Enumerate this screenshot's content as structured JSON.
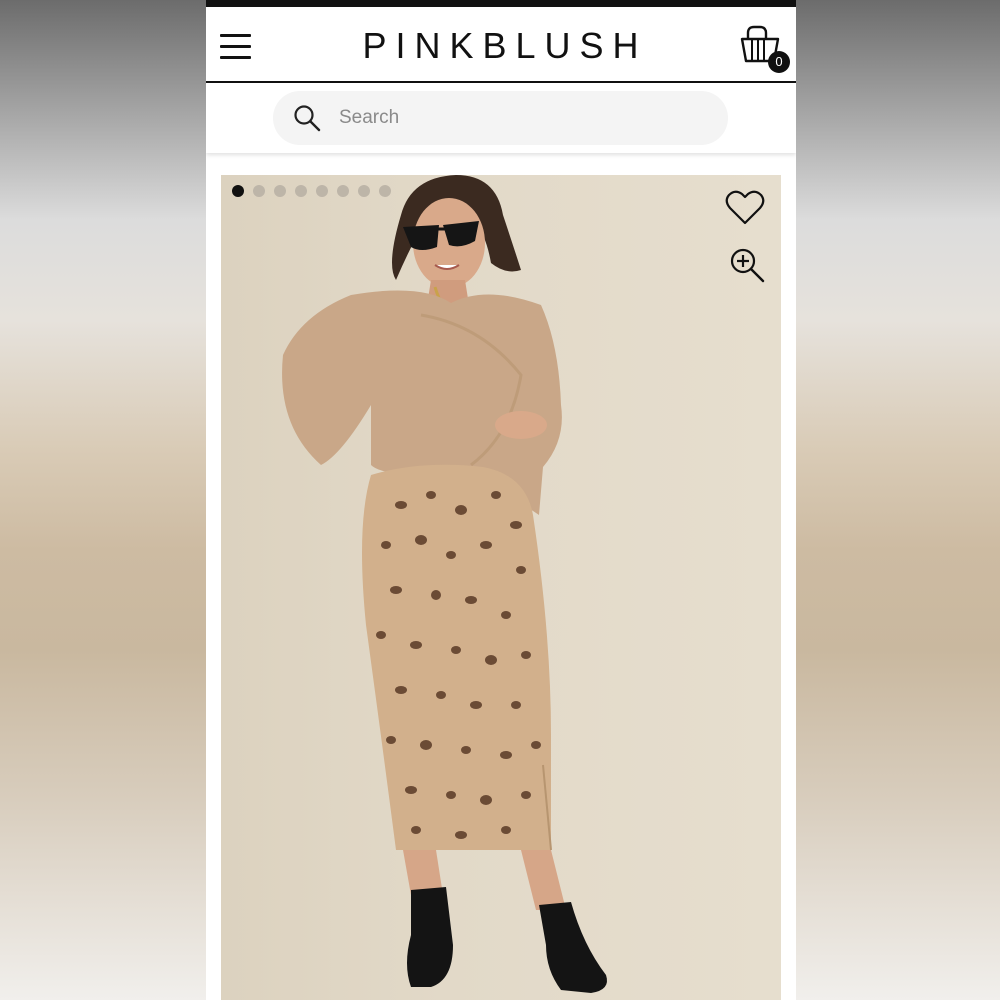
{
  "header": {
    "logo": "PINKBLUSH",
    "cart_count": "0"
  },
  "search": {
    "placeholder": "Search"
  },
  "gallery": {
    "slide_count": 8,
    "active_index": 0
  },
  "icons": {
    "menu": "menu-icon",
    "cart": "shopping-bag-icon",
    "search": "search-icon",
    "favorite": "heart-icon",
    "zoom": "zoom-in-icon"
  },
  "colors": {
    "header_text": "#111111",
    "search_bg": "#f4f4f4",
    "photo_bg": "#e2d9c8",
    "sweater": "#c9a788",
    "skirt": "#d2b08c",
    "boots": "#141414"
  }
}
